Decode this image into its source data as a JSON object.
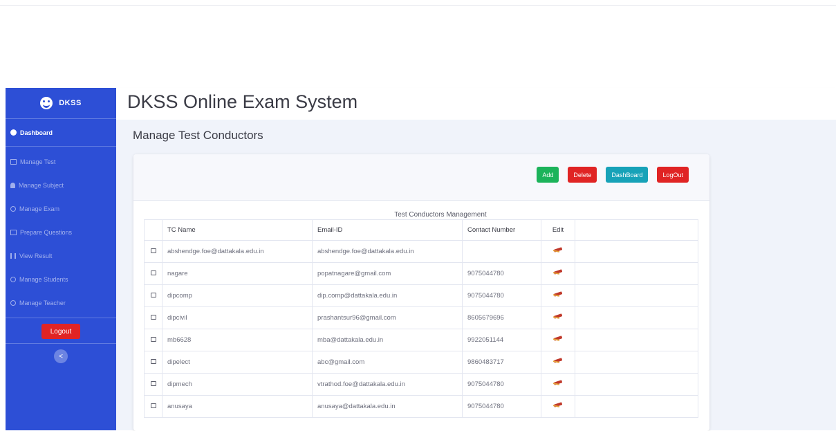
{
  "sidebar": {
    "brand": "DKSS",
    "items": [
      {
        "label": "Dashboard",
        "icon": "dashboard-icon"
      },
      {
        "label": "Manage Test",
        "icon": "grid-icon"
      },
      {
        "label": "Manage Subject",
        "icon": "user-icon"
      },
      {
        "label": "Manage Exam",
        "icon": "circle-icon"
      },
      {
        "label": "Prepare Questions",
        "icon": "grid-icon"
      },
      {
        "label": "View Result",
        "icon": "bars-icon"
      },
      {
        "label": "Manage Students",
        "icon": "circle-icon"
      },
      {
        "label": "Manage Teacher",
        "icon": "circle-icon"
      }
    ],
    "logout_label": "Logout",
    "collapse_label": "<"
  },
  "header": {
    "title": "DKSS Online Exam System"
  },
  "page": {
    "heading": "Manage Test Conductors"
  },
  "actions": {
    "add": "Add",
    "delete": "Delete",
    "dashboard": "DashBoard",
    "logout": "LogOut"
  },
  "table": {
    "caption": "Test Conductors Management",
    "headers": [
      "TC Name",
      "Email-ID",
      "Contact Number",
      "Edit"
    ],
    "rows": [
      {
        "name": "abshendge.foe@dattakala.edu.in",
        "email": "abshendge.foe@dattakala.edu.in",
        "contact": ""
      },
      {
        "name": "nagare",
        "email": "popatnagare@gmail.com",
        "contact": "9075044780"
      },
      {
        "name": "dipcomp",
        "email": "dip.comp@dattakala.edu.in",
        "contact": "9075044780"
      },
      {
        "name": "dipcivil",
        "email": "prashantsur96@gmail.com",
        "contact": "8605679696"
      },
      {
        "name": "mb6628",
        "email": "mba@dattakala.edu.in",
        "contact": "9922051144"
      },
      {
        "name": "dipelect",
        "email": "abc@gmail.com",
        "contact": "9860483717"
      },
      {
        "name": "dipmech",
        "email": "vtrathod.foe@dattakala.edu.in",
        "contact": "9075044780"
      },
      {
        "name": "anusaya",
        "email": "anusaya@dattakala.edu.in",
        "contact": "9075044780"
      }
    ]
  }
}
